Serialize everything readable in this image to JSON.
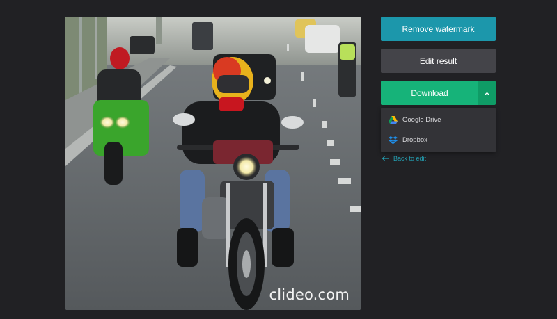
{
  "preview": {
    "watermark_text": "clideo.com"
  },
  "actions": {
    "remove_watermark_label": "Remove watermark",
    "edit_result_label": "Edit result",
    "download_label": "Download",
    "download_menu_icon": "chevron-up-icon"
  },
  "download_menu": {
    "items": [
      {
        "label": "Google Drive",
        "icon": "google-drive-icon"
      },
      {
        "label": "Dropbox",
        "icon": "dropbox-icon"
      }
    ]
  },
  "back": {
    "label": "Back to edit",
    "icon": "arrow-left-icon"
  },
  "colors": {
    "background": "#212124",
    "remove_watermark": "#1c97ab",
    "edit_result": "#444449",
    "download": "#16b379",
    "download_toggle": "#0f9c66",
    "link": "#23a0b3"
  }
}
